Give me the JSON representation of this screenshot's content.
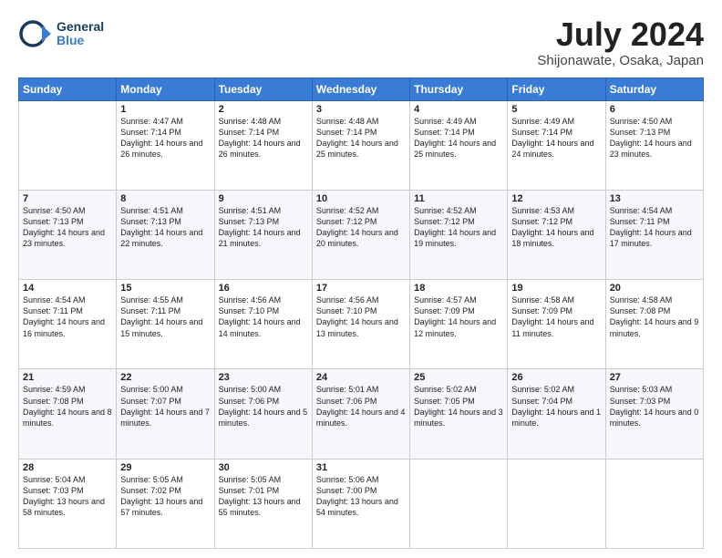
{
  "header": {
    "logo_general": "General",
    "logo_blue": "Blue",
    "title": "July 2024",
    "location": "Shijonawate, Osaka, Japan"
  },
  "days_of_week": [
    "Sunday",
    "Monday",
    "Tuesday",
    "Wednesday",
    "Thursday",
    "Friday",
    "Saturday"
  ],
  "weeks": [
    [
      {
        "day": "",
        "sunrise": "",
        "sunset": "",
        "daylight": ""
      },
      {
        "day": "1",
        "sunrise": "Sunrise: 4:47 AM",
        "sunset": "Sunset: 7:14 PM",
        "daylight": "Daylight: 14 hours and 26 minutes."
      },
      {
        "day": "2",
        "sunrise": "Sunrise: 4:48 AM",
        "sunset": "Sunset: 7:14 PM",
        "daylight": "Daylight: 14 hours and 26 minutes."
      },
      {
        "day": "3",
        "sunrise": "Sunrise: 4:48 AM",
        "sunset": "Sunset: 7:14 PM",
        "daylight": "Daylight: 14 hours and 25 minutes."
      },
      {
        "day": "4",
        "sunrise": "Sunrise: 4:49 AM",
        "sunset": "Sunset: 7:14 PM",
        "daylight": "Daylight: 14 hours and 25 minutes."
      },
      {
        "day": "5",
        "sunrise": "Sunrise: 4:49 AM",
        "sunset": "Sunset: 7:14 PM",
        "daylight": "Daylight: 14 hours and 24 minutes."
      },
      {
        "day": "6",
        "sunrise": "Sunrise: 4:50 AM",
        "sunset": "Sunset: 7:13 PM",
        "daylight": "Daylight: 14 hours and 23 minutes."
      }
    ],
    [
      {
        "day": "7",
        "sunrise": "Sunrise: 4:50 AM",
        "sunset": "Sunset: 7:13 PM",
        "daylight": "Daylight: 14 hours and 23 minutes."
      },
      {
        "day": "8",
        "sunrise": "Sunrise: 4:51 AM",
        "sunset": "Sunset: 7:13 PM",
        "daylight": "Daylight: 14 hours and 22 minutes."
      },
      {
        "day": "9",
        "sunrise": "Sunrise: 4:51 AM",
        "sunset": "Sunset: 7:13 PM",
        "daylight": "Daylight: 14 hours and 21 minutes."
      },
      {
        "day": "10",
        "sunrise": "Sunrise: 4:52 AM",
        "sunset": "Sunset: 7:12 PM",
        "daylight": "Daylight: 14 hours and 20 minutes."
      },
      {
        "day": "11",
        "sunrise": "Sunrise: 4:52 AM",
        "sunset": "Sunset: 7:12 PM",
        "daylight": "Daylight: 14 hours and 19 minutes."
      },
      {
        "day": "12",
        "sunrise": "Sunrise: 4:53 AM",
        "sunset": "Sunset: 7:12 PM",
        "daylight": "Daylight: 14 hours and 18 minutes."
      },
      {
        "day": "13",
        "sunrise": "Sunrise: 4:54 AM",
        "sunset": "Sunset: 7:11 PM",
        "daylight": "Daylight: 14 hours and 17 minutes."
      }
    ],
    [
      {
        "day": "14",
        "sunrise": "Sunrise: 4:54 AM",
        "sunset": "Sunset: 7:11 PM",
        "daylight": "Daylight: 14 hours and 16 minutes."
      },
      {
        "day": "15",
        "sunrise": "Sunrise: 4:55 AM",
        "sunset": "Sunset: 7:11 PM",
        "daylight": "Daylight: 14 hours and 15 minutes."
      },
      {
        "day": "16",
        "sunrise": "Sunrise: 4:56 AM",
        "sunset": "Sunset: 7:10 PM",
        "daylight": "Daylight: 14 hours and 14 minutes."
      },
      {
        "day": "17",
        "sunrise": "Sunrise: 4:56 AM",
        "sunset": "Sunset: 7:10 PM",
        "daylight": "Daylight: 14 hours and 13 minutes."
      },
      {
        "day": "18",
        "sunrise": "Sunrise: 4:57 AM",
        "sunset": "Sunset: 7:09 PM",
        "daylight": "Daylight: 14 hours and 12 minutes."
      },
      {
        "day": "19",
        "sunrise": "Sunrise: 4:58 AM",
        "sunset": "Sunset: 7:09 PM",
        "daylight": "Daylight: 14 hours and 11 minutes."
      },
      {
        "day": "20",
        "sunrise": "Sunrise: 4:58 AM",
        "sunset": "Sunset: 7:08 PM",
        "daylight": "Daylight: 14 hours and 9 minutes."
      }
    ],
    [
      {
        "day": "21",
        "sunrise": "Sunrise: 4:59 AM",
        "sunset": "Sunset: 7:08 PM",
        "daylight": "Daylight: 14 hours and 8 minutes."
      },
      {
        "day": "22",
        "sunrise": "Sunrise: 5:00 AM",
        "sunset": "Sunset: 7:07 PM",
        "daylight": "Daylight: 14 hours and 7 minutes."
      },
      {
        "day": "23",
        "sunrise": "Sunrise: 5:00 AM",
        "sunset": "Sunset: 7:06 PM",
        "daylight": "Daylight: 14 hours and 5 minutes."
      },
      {
        "day": "24",
        "sunrise": "Sunrise: 5:01 AM",
        "sunset": "Sunset: 7:06 PM",
        "daylight": "Daylight: 14 hours and 4 minutes."
      },
      {
        "day": "25",
        "sunrise": "Sunrise: 5:02 AM",
        "sunset": "Sunset: 7:05 PM",
        "daylight": "Daylight: 14 hours and 3 minutes."
      },
      {
        "day": "26",
        "sunrise": "Sunrise: 5:02 AM",
        "sunset": "Sunset: 7:04 PM",
        "daylight": "Daylight: 14 hours and 1 minute."
      },
      {
        "day": "27",
        "sunrise": "Sunrise: 5:03 AM",
        "sunset": "Sunset: 7:03 PM",
        "daylight": "Daylight: 14 hours and 0 minutes."
      }
    ],
    [
      {
        "day": "28",
        "sunrise": "Sunrise: 5:04 AM",
        "sunset": "Sunset: 7:03 PM",
        "daylight": "Daylight: 13 hours and 58 minutes."
      },
      {
        "day": "29",
        "sunrise": "Sunrise: 5:05 AM",
        "sunset": "Sunset: 7:02 PM",
        "daylight": "Daylight: 13 hours and 57 minutes."
      },
      {
        "day": "30",
        "sunrise": "Sunrise: 5:05 AM",
        "sunset": "Sunset: 7:01 PM",
        "daylight": "Daylight: 13 hours and 55 minutes."
      },
      {
        "day": "31",
        "sunrise": "Sunrise: 5:06 AM",
        "sunset": "Sunset: 7:00 PM",
        "daylight": "Daylight: 13 hours and 54 minutes."
      },
      {
        "day": "",
        "sunrise": "",
        "sunset": "",
        "daylight": ""
      },
      {
        "day": "",
        "sunrise": "",
        "sunset": "",
        "daylight": ""
      },
      {
        "day": "",
        "sunrise": "",
        "sunset": "",
        "daylight": ""
      }
    ]
  ]
}
